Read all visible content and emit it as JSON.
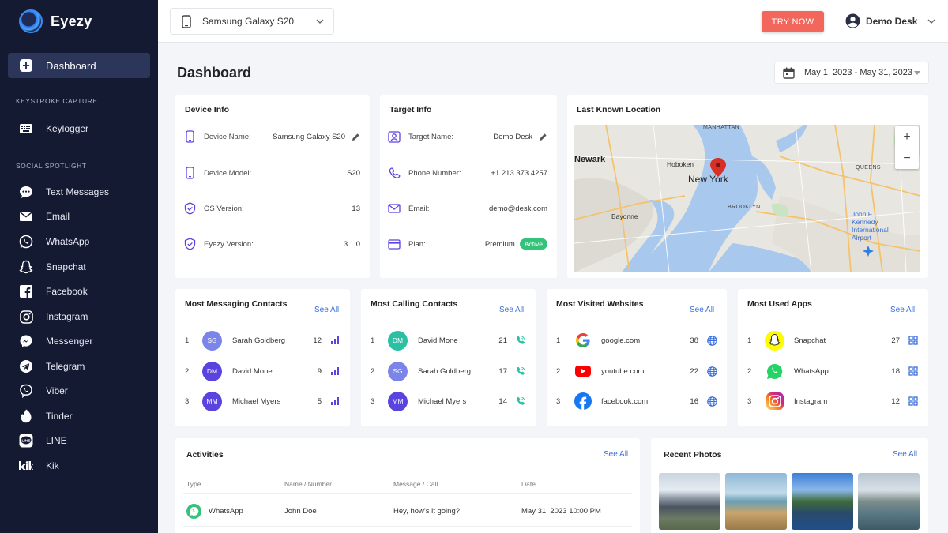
{
  "sidebar": {
    "brand": "Eyezy",
    "active": "Dashboard",
    "section_keystroke": "KEYSTROKE CAPTURE",
    "keylogger": "Keylogger",
    "section_social": "SOCIAL SPOTLIGHT",
    "items": [
      {
        "label": "Text Messages",
        "icon": "chat-bubble-icon"
      },
      {
        "label": "Email",
        "icon": "envelope-icon"
      },
      {
        "label": "WhatsApp",
        "icon": "whatsapp-icon"
      },
      {
        "label": "Snapchat",
        "icon": "snapchat-ghost-icon"
      },
      {
        "label": "Facebook",
        "icon": "facebook-icon"
      },
      {
        "label": "Instagram",
        "icon": "instagram-icon"
      },
      {
        "label": "Messenger",
        "icon": "messenger-icon"
      },
      {
        "label": "Telegram",
        "icon": "telegram-icon"
      },
      {
        "label": "Viber",
        "icon": "viber-icon"
      },
      {
        "label": "Tinder",
        "icon": "flame-icon"
      },
      {
        "label": "LINE",
        "icon": "line-icon"
      },
      {
        "label": "Kik",
        "icon": "kik-icon"
      }
    ]
  },
  "topbar": {
    "device": "Samsung Galaxy S20",
    "try_now": "TRY NOW",
    "user": "Demo Desk"
  },
  "page": {
    "title": "Dashboard",
    "date_range": "May 1, 2023 - May 31, 2023"
  },
  "device_info": {
    "title": "Device Info",
    "rows": [
      {
        "label": "Device Name:",
        "value": "Samsung Galaxy S20"
      },
      {
        "label": "Device Model:",
        "value": "S20"
      },
      {
        "label": "OS Version:",
        "value": "13"
      },
      {
        "label": "Eyezy Version:",
        "value": "3.1.0"
      }
    ]
  },
  "target_info": {
    "title": "Target Info",
    "rows": [
      {
        "label": "Target Name:",
        "value": "Demo Desk"
      },
      {
        "label": "Phone Number:",
        "value": "+1 213 373 4257"
      },
      {
        "label": "Email:",
        "value": "demo@desk.com"
      },
      {
        "label": "Plan:",
        "value": "Premium"
      }
    ],
    "plan_status": "Active"
  },
  "location": {
    "title": "Last Known Location",
    "labels": {
      "newark": "Newark",
      "hoboken": "Hoboken",
      "newyork": "New York",
      "manhattan": "MANHATTAN",
      "queens": "QUEENS",
      "brooklyn": "BROOKLYN",
      "bayonne": "Bayonne",
      "jfk": "John F. Kennedy International Airport"
    }
  },
  "messaging": {
    "title": "Most Messaging Contacts",
    "see_all": "See All",
    "rows": [
      {
        "rank": "1",
        "initials": "SG",
        "name": "Sarah Goldberg",
        "count": "12",
        "color": "#7b84e8"
      },
      {
        "rank": "2",
        "initials": "DM",
        "name": "David Mone",
        "count": "9",
        "color": "#5a44e0"
      },
      {
        "rank": "3",
        "initials": "MM",
        "name": "Michael Myers",
        "count": "5",
        "color": "#5a44e0"
      }
    ]
  },
  "calling": {
    "title": "Most Calling Contacts",
    "see_all": "See All",
    "rows": [
      {
        "rank": "1",
        "initials": "DM",
        "name": "David Mone",
        "count": "21",
        "color": "#2bbfa4"
      },
      {
        "rank": "2",
        "initials": "SG",
        "name": "Sarah Goldberg",
        "count": "17",
        "color": "#7b84e8"
      },
      {
        "rank": "3",
        "initials": "MM",
        "name": "Michael Myers",
        "count": "14",
        "color": "#5a44e0"
      }
    ]
  },
  "websites": {
    "title": "Most Visited Websites",
    "see_all": "See All",
    "rows": [
      {
        "rank": "1",
        "name": "google.com",
        "count": "38",
        "icon": "google-icon"
      },
      {
        "rank": "2",
        "name": "youtube.com",
        "count": "22",
        "icon": "youtube-icon"
      },
      {
        "rank": "3",
        "name": "facebook.com",
        "count": "16",
        "icon": "facebook-icon"
      }
    ]
  },
  "apps": {
    "title": "Most Used Apps",
    "see_all": "See All",
    "rows": [
      {
        "rank": "1",
        "name": "Snapchat",
        "count": "27",
        "icon": "snapchat-icon"
      },
      {
        "rank": "2",
        "name": "WhatsApp",
        "count": "18",
        "icon": "whatsapp-icon"
      },
      {
        "rank": "3",
        "name": "Instagram",
        "count": "12",
        "icon": "instagram-icon"
      }
    ]
  },
  "activities": {
    "title": "Activities",
    "see_all": "See All",
    "columns": [
      "Type",
      "Name / Number",
      "Message / Call",
      "Date"
    ],
    "rows": [
      {
        "type": "WhatsApp",
        "name": "John Doe",
        "message": "Hey, how's it going?",
        "date": "May 31, 2023 10:00 PM"
      }
    ]
  },
  "photos": {
    "title": "Recent Photos",
    "see_all": "See All"
  },
  "colors": {
    "sidebar_bg": "#141a32",
    "accent": "#5a44e0",
    "try_now": "#f2665c",
    "link": "#3a6fd8",
    "active_badge": "#34c37a"
  }
}
